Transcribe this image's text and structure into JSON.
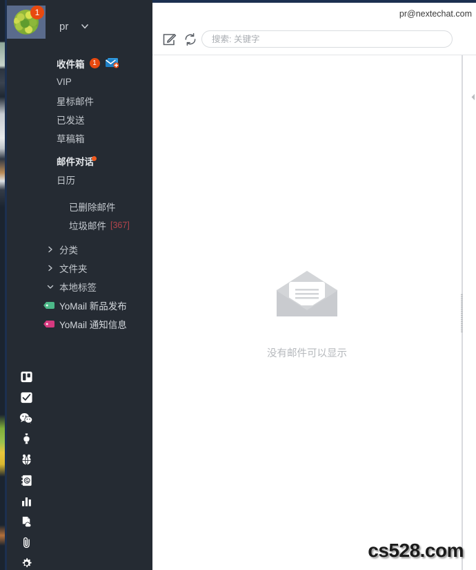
{
  "window": {
    "account_email": "pr@nextechat.com",
    "watermark": "cs528.com"
  },
  "sidebar": {
    "account": {
      "name": "pr",
      "avatar_badge": "1",
      "avatar_icon": "avatar-image",
      "caret_icon": "chevron-down-icon"
    },
    "items": [
      {
        "label": "收件箱",
        "bold": true,
        "badge": "1",
        "icon": "new-mail-icon"
      },
      {
        "label": "VIP",
        "bold": false
      },
      {
        "label": "星标邮件",
        "bold": false
      },
      {
        "label": "已发送",
        "bold": false
      },
      {
        "label": "草稿箱",
        "bold": false
      },
      {
        "label": "邮件对话",
        "bold": true,
        "dot": true
      },
      {
        "label": "日历",
        "bold": false
      },
      {
        "label": "已删除邮件",
        "bold": false,
        "indent": true
      },
      {
        "label": "垃圾邮件",
        "bold": false,
        "indent": true,
        "count": "[367]"
      }
    ],
    "groups": [
      {
        "label": "分类",
        "expanded": false,
        "icon": "chevron-right-icon"
      },
      {
        "label": "文件夹",
        "expanded": false,
        "icon": "chevron-right-icon"
      },
      {
        "label": "本地标签",
        "expanded": true,
        "icon": "chevron-down-icon"
      }
    ],
    "tags": [
      {
        "label": "YoMail 新品发布",
        "color": "#4cb888",
        "icon": "tag-icon"
      },
      {
        "label": "YoMail 通知信息",
        "color": "#d6397f",
        "icon": "tag-icon"
      }
    ],
    "rail": [
      {
        "icon": "board-icon",
        "name": "board"
      },
      {
        "icon": "task-checkbox-icon",
        "name": "tasks"
      },
      {
        "icon": "wechat-icon",
        "name": "wechat"
      },
      {
        "icon": "plugin-puzzle-icon",
        "name": "plugins"
      },
      {
        "icon": "group-globe-icon",
        "name": "groups"
      },
      {
        "icon": "address-book-icon",
        "name": "contacts"
      },
      {
        "icon": "bar-chart-icon",
        "name": "statistics"
      },
      {
        "icon": "cloud-file-icon",
        "name": "cloud-files"
      },
      {
        "icon": "paperclip-icon",
        "name": "attachments"
      },
      {
        "icon": "gear-icon",
        "name": "settings"
      }
    ]
  },
  "toolbar": {
    "compose_icon": "compose-icon",
    "refresh_icon": "refresh-icon",
    "search": {
      "placeholder": "搜索: 关键字",
      "value": ""
    }
  },
  "list_pane": {
    "empty_icon": "open-envelope-icon",
    "empty_text": "没有邮件可以显示"
  },
  "colors": {
    "sidebar_bg": "#252b33",
    "badge_orange": "#e8490f",
    "count_red": "#b4444c",
    "titlebar_navy": "#1c3050",
    "tag_green": "#4cb888",
    "tag_pink": "#d6397f"
  }
}
